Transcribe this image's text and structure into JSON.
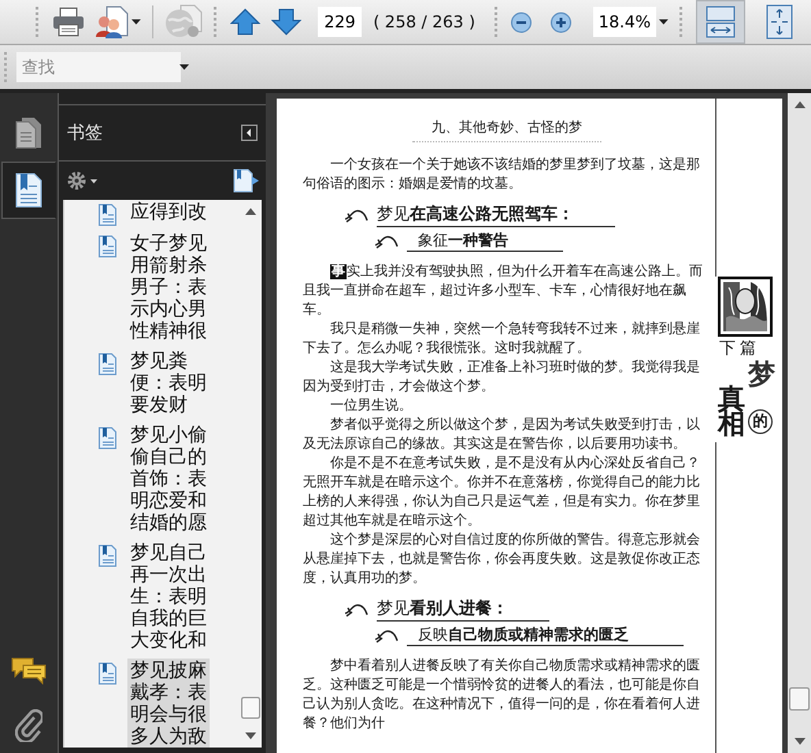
{
  "toolbar": {
    "page_number": "229",
    "page_count": "( 258 / 263 )",
    "zoom": "18.4%",
    "view_buttons": [
      {
        "kind": "fit-width",
        "selected": true
      },
      {
        "kind": "fit-page",
        "selected": false
      }
    ]
  },
  "find": {
    "placeholder": "查找"
  },
  "side_tabs": [
    {
      "kind": "pages",
      "selected": false
    },
    {
      "kind": "bookmarks",
      "selected": true
    }
  ],
  "bookmarks": {
    "title": "书签",
    "items": [
      {
        "text": "应得到改",
        "selected": false
      },
      {
        "text": "女子梦见用箭射杀男子：表示内心男性精神很",
        "selected": false
      },
      {
        "text": "梦见粪便：表明要发财",
        "selected": false
      },
      {
        "text": "梦见小偷偷自己的首饰：表明恋爱和结婚的愿",
        "selected": false
      },
      {
        "text": "梦见自己再一次出生：表明自我的巨大变化和",
        "selected": false
      },
      {
        "text": "梦见披麻戴孝：表明会与很多人为敌",
        "selected": true
      }
    ]
  },
  "page": {
    "header": "九、其他奇妙、古怪的梦",
    "side": {
      "label": "下 篇",
      "chars": [
        "梦",
        "的",
        "真",
        "相"
      ]
    },
    "blocks": [
      {
        "kind": "para",
        "text": "一个女孩在一个关于她该不该结婚的梦里梦到了坟墓，这是那句俗语的图示：婚姻是爱情的坟墓。"
      },
      {
        "kind": "heading",
        "title": "梦见**在高速公路无照驾车：**",
        "subtitle": "象征**一种警告**"
      },
      {
        "kind": "para",
        "dropcap": "事",
        "text": "实上我并没有驾驶执照，但为什么开着车在高速公路上。而且我一直拼命在超车，超过许多小型车、卡车，心情很好地在飙车。"
      },
      {
        "kind": "para",
        "text": "我只是稍微一失神，突然一个急转弯我转不过来，就摔到悬崖下去了。怎么办呢？我很慌张。这时我就醒了。"
      },
      {
        "kind": "para",
        "text": "这是我大学考试失败，正准备上补习班时做的梦。我觉得我是因为受到打击，才会做这个梦。"
      },
      {
        "kind": "para",
        "text": "一位男生说。"
      },
      {
        "kind": "para",
        "text": "梦者似乎觉得之所以做这个梦，是因为考试失败受到打击，以及无法原谅自己的缘故。其实这是在警告你，以后要用功读书。"
      },
      {
        "kind": "para",
        "text": "你是不是不在意考试失败，是不是没有从内心深处反省自己？无照开车就是在暗示这个。你并不在意落榜，你觉得自己的能力比上榜的人来得强，你认为自己只是运气差，但是有实力。你在梦里超过其他车就是在暗示这个。"
      },
      {
        "kind": "para",
        "text": "这个梦是深层的心对自信过度的你所做的警告。得意忘形就会从悬崖掉下去，也就是警告你，你会再度失败。这是敦促你改正态度，认真用功的梦。"
      },
      {
        "kind": "heading",
        "title": "梦见**看别人进餐：**",
        "subtitle": "反映**自己物质或精神需求的匮乏**"
      },
      {
        "kind": "para",
        "text": "梦中看着别人进餐反映了有关你自己物质需求或精神需求的匮乏。这种匮乏可能是一个惜弱怜贫的进餐人的看法，也可能是你自己认为别人贪吃。在这种情况下，值得一问的是，你在看着何人进餐？他们为什"
      }
    ]
  }
}
